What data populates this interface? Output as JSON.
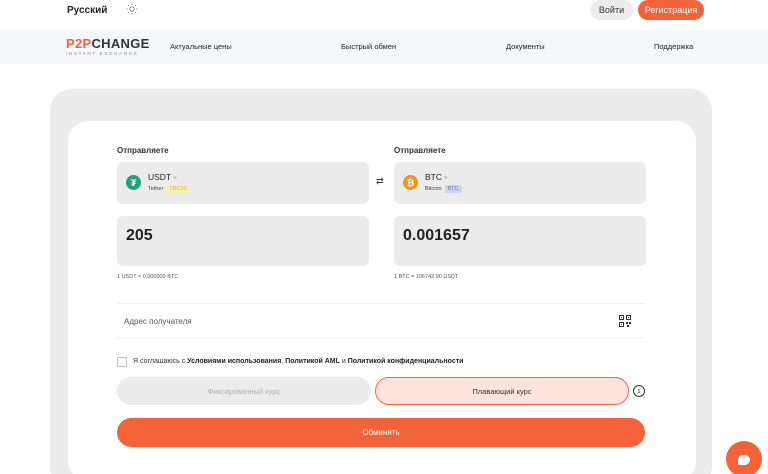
{
  "topbar": {
    "language": "Русский",
    "login_label": "Войти",
    "register_label": "Регистрация"
  },
  "nav": {
    "logo_main_accent": "P2P",
    "logo_main_rest": "CHANGE",
    "logo_sub": "INSTANT EXCHANGE",
    "items": [
      "Актуальные цены",
      "Быстрый обмен",
      "Документы",
      "Поддержка"
    ]
  },
  "exchange": {
    "send": {
      "label": "Отправляете",
      "code": "USDT",
      "name": "Tether",
      "tag": "TRC20",
      "amount": "205",
      "rate": "1 USDT = 0.000009 BTC"
    },
    "receive": {
      "label": "Отправляете",
      "code": "BTC",
      "name": "Bitcoin",
      "tag": "BTC",
      "amount": "0.001657",
      "rate": "1 BTC = 106742.90 USDT"
    },
    "address_placeholder": "Адрес получателя",
    "agreement": {
      "prefix": "Я соглашаюсь с ",
      "terms": "Условиями использования",
      "sep1": ", ",
      "aml": "Политикой AML",
      "sep2": " и ",
      "privacy": "Политикой конфиденциальности"
    },
    "fixed_rate_label": "Фиксированный курс",
    "float_rate_label": "Плавающий курс",
    "submit_label": "Обменять"
  },
  "colors": {
    "accent": "#f4623a",
    "usdt": "#26a17b",
    "btc": "#f7931a"
  },
  "icons": [
    "sun-icon",
    "swap-icon",
    "qr-code-icon",
    "info-icon",
    "chat-icon",
    "chevron-down-icon"
  ]
}
